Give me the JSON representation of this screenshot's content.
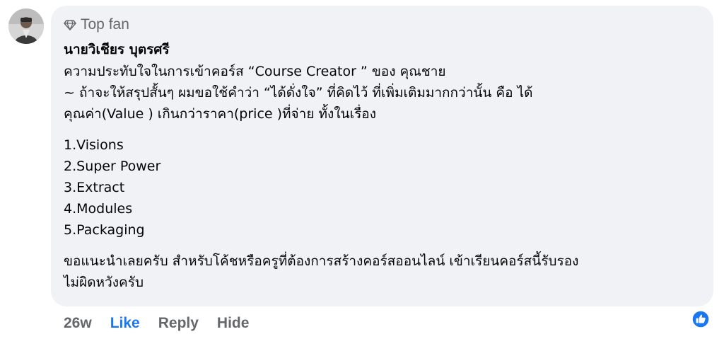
{
  "badge": {
    "icon": "diamond-icon",
    "label": "Top fan"
  },
  "comment": {
    "author": "นายวิเชียร บุตรศรี",
    "intro_lines": [
      "ความประทับใจในการเข้าคอร์ส “Course Creator ” ของ คุณชาย",
      "~ ถ้าจะให้สรุปสั้นๆ ผมขอใช้คำว่า “ได้ดั่งใจ” ที่คิดไว้ ที่เพิ่มเติมมากกว่านั้น คือ ได้",
      "คุณค่า(Value ) เกินกว่าราคา(price )ที่จ่าย ทั้งในเรื่อง"
    ],
    "list_items": [
      "1.Visions",
      "2.Super Power",
      "3.Extract",
      "4.Modules",
      "5.Packaging"
    ],
    "outro_lines": [
      "ขอแนะนำเลยครับ สำหรับโค้ชหรือครูที่ต้องการสร้างคอร์สออนไลน์ เข้าเรียนคอร์สนี้รับรอง",
      "ไม่ผิดหวังครับ"
    ]
  },
  "actions": {
    "time": "26w",
    "like": "Like",
    "reply": "Reply",
    "hide": "Hide"
  },
  "reaction": {
    "icon": "thumbs-up-reaction-icon"
  },
  "colors": {
    "bubble_bg": "#f0f2f5",
    "muted_text": "#65676b",
    "like_blue": "#1877f2",
    "text": "#050505"
  }
}
